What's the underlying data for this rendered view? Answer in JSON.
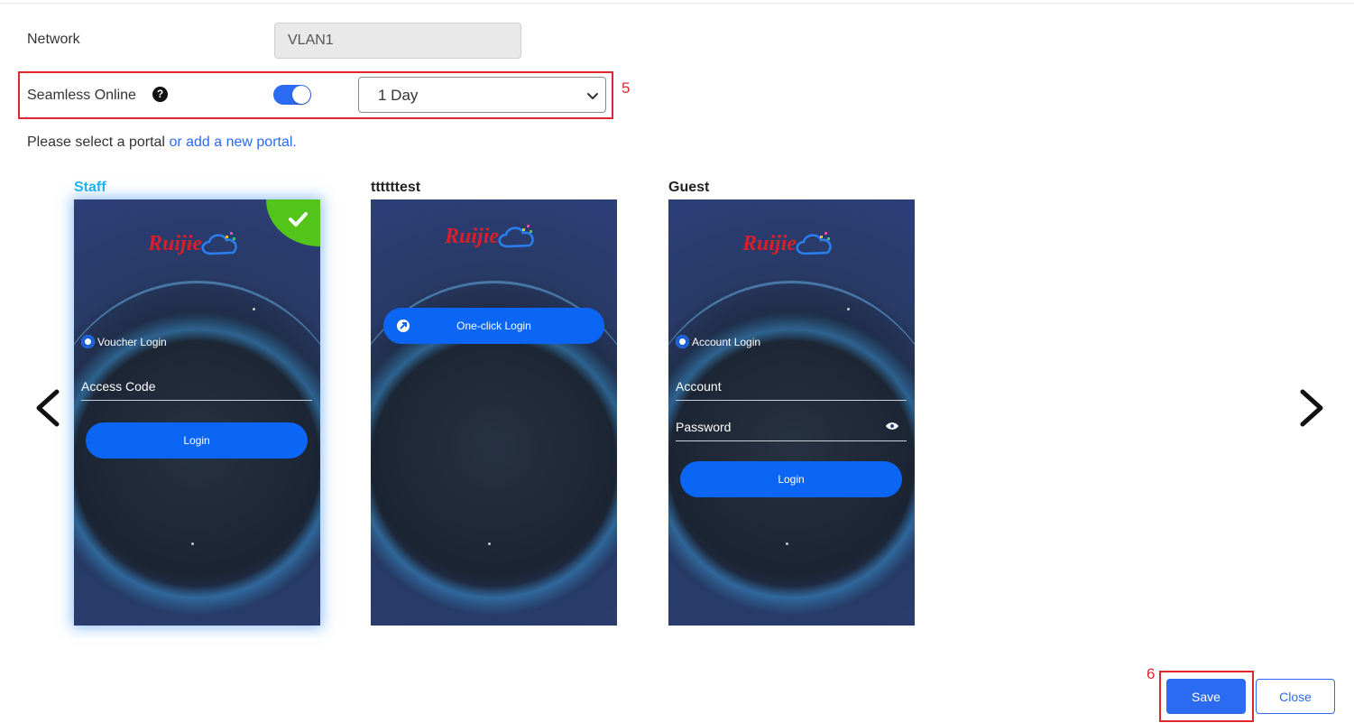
{
  "form": {
    "network_label": "Network",
    "network_value": "VLAN1",
    "seamless_label": "Seamless Online",
    "seamless_enabled": true,
    "seamless_duration": "1 Day",
    "portal_hint_prefix": "Please select a portal",
    "portal_hint_link": "or add a new portal."
  },
  "annotations": {
    "step5": "5",
    "step6": "6"
  },
  "portals": [
    {
      "name": "Staff",
      "selected": true,
      "login_type": "Voucher Login",
      "fields": [
        "Access Code"
      ],
      "button": "Login"
    },
    {
      "name": "ttttttest",
      "selected": false,
      "button": "One-click Login"
    },
    {
      "name": "Guest",
      "selected": false,
      "login_type": "Account Login",
      "fields": [
        "Account",
        "Password"
      ],
      "button": "Login"
    }
  ],
  "brand": {
    "logo_text": "Ruijie"
  },
  "actions": {
    "save_label": "Save",
    "close_label": "Close"
  },
  "colors": {
    "accent": "#2b6bf2",
    "annotation": "#e0262f",
    "selected_title": "#1fb4f2",
    "selected_check": "#52c41a",
    "portal_button": "#0b66f5"
  },
  "icons": [
    "help-icon",
    "chevron-down-icon",
    "check-icon",
    "ticket-icon",
    "link-icon",
    "user-icon",
    "eye-icon",
    "chevron-left-icon",
    "chevron-right-icon"
  ]
}
